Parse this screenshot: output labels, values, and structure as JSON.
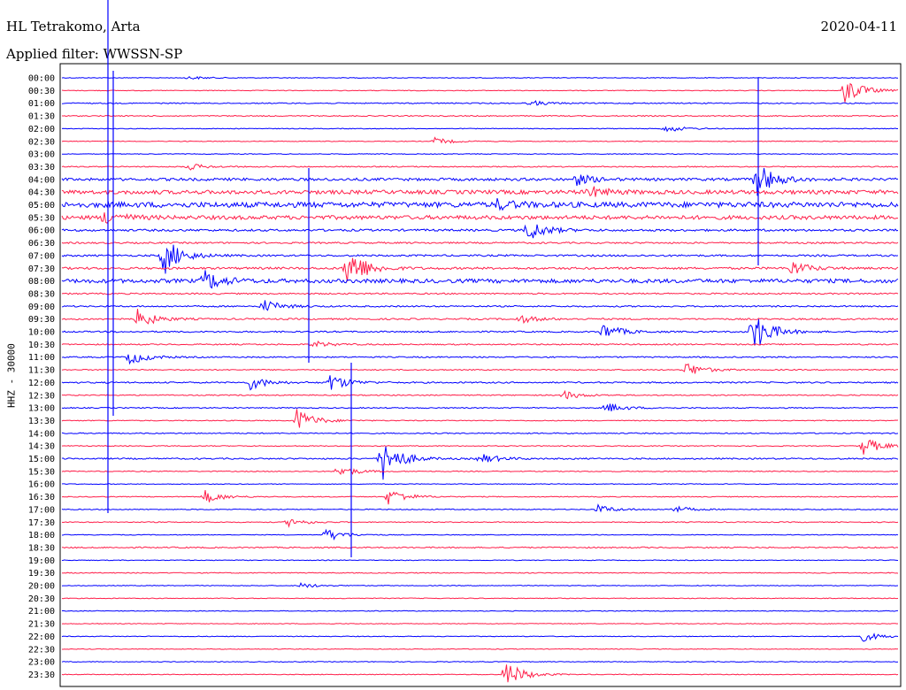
{
  "header": {
    "station": "HL Tetrakomo, Arta",
    "date": "2020-04-11",
    "filter_label": "Applied filter: WWSSN-SP"
  },
  "axis": {
    "ylabel": "HHZ - 30000"
  },
  "colors": {
    "trace_a": "#0000ff",
    "trace_b": "#ff1f4a"
  },
  "chart_data": {
    "type": "line",
    "title": "HL Tetrakomo, Arta",
    "subtitle": "Applied filter: WWSSN-SP",
    "ylabel": "HHZ - 30000",
    "xlabel": "",
    "grid": false,
    "legend": "none",
    "row_labels": [
      "00:00",
      "00:30",
      "01:00",
      "01:30",
      "02:00",
      "02:30",
      "03:00",
      "03:30",
      "04:00",
      "04:30",
      "05:00",
      "05:30",
      "06:00",
      "06:30",
      "07:00",
      "07:30",
      "08:00",
      "08:30",
      "09:00",
      "09:30",
      "10:00",
      "10:30",
      "11:00",
      "11:30",
      "12:00",
      "12:30",
      "13:00",
      "13:30",
      "14:00",
      "14:30",
      "15:00",
      "15:30",
      "16:00",
      "16:30",
      "17:00",
      "17:30",
      "18:00",
      "18:30",
      "19:00",
      "19:30",
      "20:00",
      "20:30",
      "21:00",
      "21:30",
      "22:00",
      "22:30",
      "23:00",
      "23:30"
    ],
    "row_colors": [
      "blue",
      "red"
    ],
    "row_noise": [
      0.4,
      0.4,
      0.6,
      0.6,
      0.4,
      0.4,
      0.4,
      0.6,
      1.5,
      2.2,
      3.0,
      2.2,
      1.2,
      0.9,
      1.0,
      1.2,
      2.2,
      0.8,
      0.8,
      0.9,
      0.8,
      0.7,
      0.7,
      0.6,
      0.8,
      0.6,
      0.6,
      0.5,
      0.6,
      0.5,
      0.8,
      0.5,
      0.4,
      0.5,
      0.5,
      0.5,
      0.4,
      0.7,
      0.4,
      0.5,
      0.4,
      0.4,
      0.4,
      0.4,
      0.4,
      0.4,
      0.4,
      0.4
    ],
    "events": [
      {
        "row": 0,
        "t": 0.15,
        "amp": 2
      },
      {
        "row": 1,
        "t": 0.935,
        "amp": 16
      },
      {
        "row": 2,
        "t": 0.56,
        "amp": 3
      },
      {
        "row": 4,
        "t": 0.72,
        "amp": 5
      },
      {
        "row": 5,
        "t": 0.445,
        "amp": 4
      },
      {
        "row": 7,
        "t": 0.15,
        "amp": 4
      },
      {
        "row": 8,
        "t": 0.61,
        "amp": 8
      },
      {
        "row": 8,
        "t": 0.83,
        "amp": 20
      },
      {
        "row": 9,
        "t": 0.63,
        "amp": 6
      },
      {
        "row": 10,
        "t": 0.52,
        "amp": 5
      },
      {
        "row": 11,
        "t": 0.05,
        "amp": 8
      },
      {
        "row": 12,
        "t": 0.555,
        "amp": 14
      },
      {
        "row": 14,
        "t": 0.12,
        "amp": 24
      },
      {
        "row": 15,
        "t": 0.34,
        "amp": 28
      },
      {
        "row": 15,
        "t": 0.87,
        "amp": 9
      },
      {
        "row": 16,
        "t": 0.17,
        "amp": 12
      },
      {
        "row": 18,
        "t": 0.24,
        "amp": 8
      },
      {
        "row": 19,
        "t": 0.09,
        "amp": 11
      },
      {
        "row": 19,
        "t": 0.545,
        "amp": 5
      },
      {
        "row": 20,
        "t": 0.645,
        "amp": 10
      },
      {
        "row": 20,
        "t": 0.825,
        "amp": 26
      },
      {
        "row": 21,
        "t": 0.3,
        "amp": 4
      },
      {
        "row": 22,
        "t": 0.08,
        "amp": 9
      },
      {
        "row": 23,
        "t": 0.745,
        "amp": 9
      },
      {
        "row": 24,
        "t": 0.225,
        "amp": 8
      },
      {
        "row": 24,
        "t": 0.32,
        "amp": 10
      },
      {
        "row": 25,
        "t": 0.6,
        "amp": 5
      },
      {
        "row": 26,
        "t": 0.65,
        "amp": 6
      },
      {
        "row": 27,
        "t": 0.28,
        "amp": 14
      },
      {
        "row": 29,
        "t": 0.955,
        "amp": 12
      },
      {
        "row": 30,
        "t": 0.38,
        "amp": 30
      },
      {
        "row": 30,
        "t": 0.5,
        "amp": 6
      },
      {
        "row": 31,
        "t": 0.33,
        "amp": 7
      },
      {
        "row": 33,
        "t": 0.17,
        "amp": 8
      },
      {
        "row": 33,
        "t": 0.39,
        "amp": 10
      },
      {
        "row": 34,
        "t": 0.64,
        "amp": 5
      },
      {
        "row": 34,
        "t": 0.73,
        "amp": 4
      },
      {
        "row": 35,
        "t": 0.27,
        "amp": 5
      },
      {
        "row": 36,
        "t": 0.315,
        "amp": 8
      },
      {
        "row": 40,
        "t": 0.285,
        "amp": 3
      },
      {
        "row": 44,
        "t": 0.955,
        "amp": 6
      },
      {
        "row": 47,
        "t": 0.53,
        "amp": 16
      }
    ]
  }
}
